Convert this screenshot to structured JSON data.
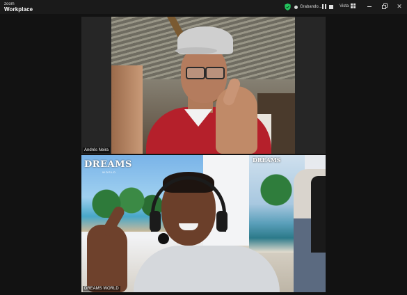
{
  "app": {
    "logo_line1": "zoom",
    "logo_line2": "Workplace"
  },
  "topbar": {
    "recording_label": "Grabando...",
    "view_label": "Vista",
    "close_glyph": "✕",
    "accent_shield": "#23c55e"
  },
  "participants": [
    {
      "name": "Andrés Neira"
    },
    {
      "name": "DREAMS WORLD"
    }
  ],
  "background_text": {
    "poster_brand": "DREAMS",
    "poster_sub": "WORLD"
  }
}
